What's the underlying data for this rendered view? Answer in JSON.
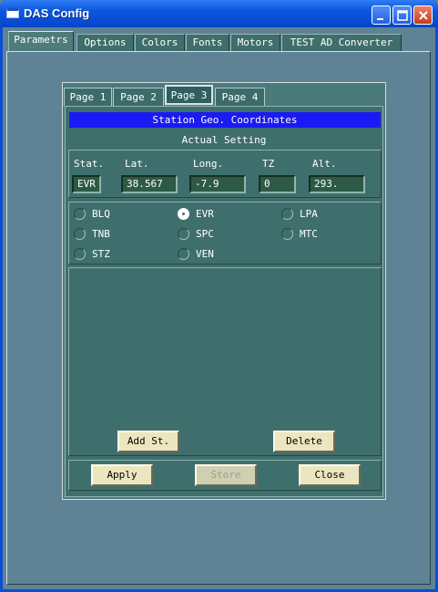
{
  "window": {
    "title": "DAS Config",
    "minimize_label": "minimize",
    "maximize_label": "maximize",
    "close_label": "close"
  },
  "outer_tabs": [
    {
      "label": "Parametrs",
      "active": true
    },
    {
      "label": "Options",
      "active": false
    },
    {
      "label": "Colors",
      "active": false
    },
    {
      "label": "Fonts",
      "active": false
    },
    {
      "label": "Motors",
      "active": false
    },
    {
      "label": "TEST AD Converter",
      "active": false
    }
  ],
  "inner_tabs": [
    {
      "label": "Page 1",
      "active": false
    },
    {
      "label": "Page 2",
      "active": false
    },
    {
      "label": "Page 3",
      "active": true
    },
    {
      "label": "Page 4",
      "active": false
    }
  ],
  "page": {
    "banner": "Station Geo. Coordinates",
    "subtitle": "Actual Setting",
    "coords": {
      "headers": [
        "Stat.",
        "Lat.",
        "Long.",
        "TZ",
        "Alt."
      ],
      "values": [
        "EVR",
        "38.567",
        "-7.9",
        "0",
        "293."
      ]
    },
    "stations": [
      {
        "label": "BLQ",
        "selected": false
      },
      {
        "label": "EVR",
        "selected": true
      },
      {
        "label": "LPA",
        "selected": false
      },
      {
        "label": "TNB",
        "selected": false
      },
      {
        "label": "SPC",
        "selected": false
      },
      {
        "label": "MTC",
        "selected": false
      },
      {
        "label": "STZ",
        "selected": false
      },
      {
        "label": "VEN",
        "selected": false
      }
    ],
    "add_button": "Add St.",
    "delete_button": "Delete",
    "apply_button": "Apply",
    "store_button": "Store",
    "close_button": "Close"
  },
  "colors": {
    "panel": "#3f6f6d",
    "banner": "#1a1af4",
    "button_face": "#ece6c0",
    "titlebar": "#0a57e0"
  }
}
